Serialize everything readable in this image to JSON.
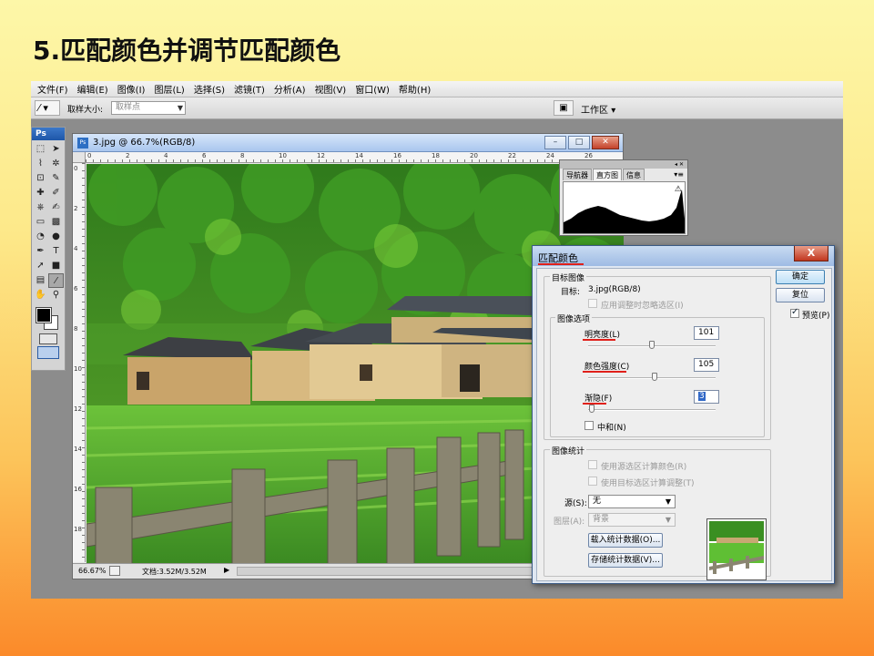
{
  "slide": {
    "title": "5.匹配颜色并调节匹配颜色"
  },
  "menubar": {
    "items": [
      {
        "label": "文件(F)"
      },
      {
        "label": "编辑(E)"
      },
      {
        "label": "图像(I)"
      },
      {
        "label": "图层(L)"
      },
      {
        "label": "选择(S)"
      },
      {
        "label": "滤镜(T)"
      },
      {
        "label": "分析(A)"
      },
      {
        "label": "视图(V)"
      },
      {
        "label": "窗口(W)"
      },
      {
        "label": "帮助(H)"
      }
    ]
  },
  "options_bar": {
    "tool_icon": "eyedropper-icon",
    "sample_size_label": "取样大小:",
    "sample_size_value": "取样点",
    "workspace_label": "工作区"
  },
  "toolbox": {
    "header": "Ps",
    "tools": [
      "marquee-icon",
      "move-icon",
      "lasso-icon",
      "magic-wand-icon",
      "crop-icon",
      "slice-icon",
      "healing-icon",
      "brush-icon",
      "stamp-icon",
      "history-brush-icon",
      "eraser-icon",
      "gradient-icon",
      "blur-icon",
      "dodge-icon",
      "pen-icon",
      "type-icon",
      "path-select-icon",
      "shape-icon",
      "notes-icon",
      "eyedropper-icon",
      "hand-icon",
      "zoom-icon"
    ],
    "tool_glyphs": [
      "⬚",
      "➤",
      "⌇",
      "✲",
      "⊡",
      "✎",
      "✚",
      "✐",
      "⎈",
      "✍",
      "▭",
      "▩",
      "◔",
      "●",
      "✒",
      "T",
      "➚",
      "■",
      "▤",
      "⁄",
      "✋",
      "⚲"
    ],
    "selected_tool": "eyedropper-icon"
  },
  "document": {
    "title": "3.jpg @ 66.7%(RGB/8)",
    "ruler_h_labels": [
      "0",
      "2",
      "4",
      "6",
      "8",
      "10",
      "12",
      "14",
      "16",
      "18",
      "20",
      "22",
      "24",
      "26"
    ],
    "ruler_v_labels": [
      "0",
      "2",
      "4",
      "6",
      "8",
      "10",
      "12",
      "14",
      "16",
      "18"
    ],
    "status_zoom": "66.67%",
    "status_doc": "文档:3.52M/3.52M"
  },
  "histogram_panel": {
    "tabs": [
      {
        "label": "导航器"
      },
      {
        "label": "直方图"
      },
      {
        "label": "信息"
      }
    ],
    "active_tab": "直方图",
    "warning_icon": "warning-icon"
  },
  "match_color_dialog": {
    "title": "匹配颜色",
    "close_glyph": "X",
    "target_section": "目标图像",
    "target_label": "目标:",
    "target_value": "3.jpg(RGB/8)",
    "ignore_selection_label": "应用调整时忽略选区(I)",
    "image_options_section": "图像选项",
    "luminance_label": "明亮度(L)",
    "luminance_value": "101",
    "luminance_slider": 0.5,
    "intensity_label": "颜色强度(C)",
    "intensity_value": "105",
    "intensity_slider": 0.52,
    "fade_label": "渐隐(F)",
    "fade_value": "3",
    "fade_slider": 0.03,
    "neutralize_label": "中和(N)",
    "stats_section": "图像统计",
    "use_source_selection_label": "使用源选区计算颜色(R)",
    "use_target_selection_label": "使用目标选区计算调整(T)",
    "source_label": "源(S):",
    "source_value": "无",
    "layer_label": "图层(A):",
    "layer_value": "背景",
    "load_stats_button": "载入统计数据(O)...",
    "save_stats_button": "存储统计数据(V)...",
    "ok_button": "确定",
    "reset_button": "复位",
    "preview_label": "预览(P)",
    "preview_checked": true
  }
}
